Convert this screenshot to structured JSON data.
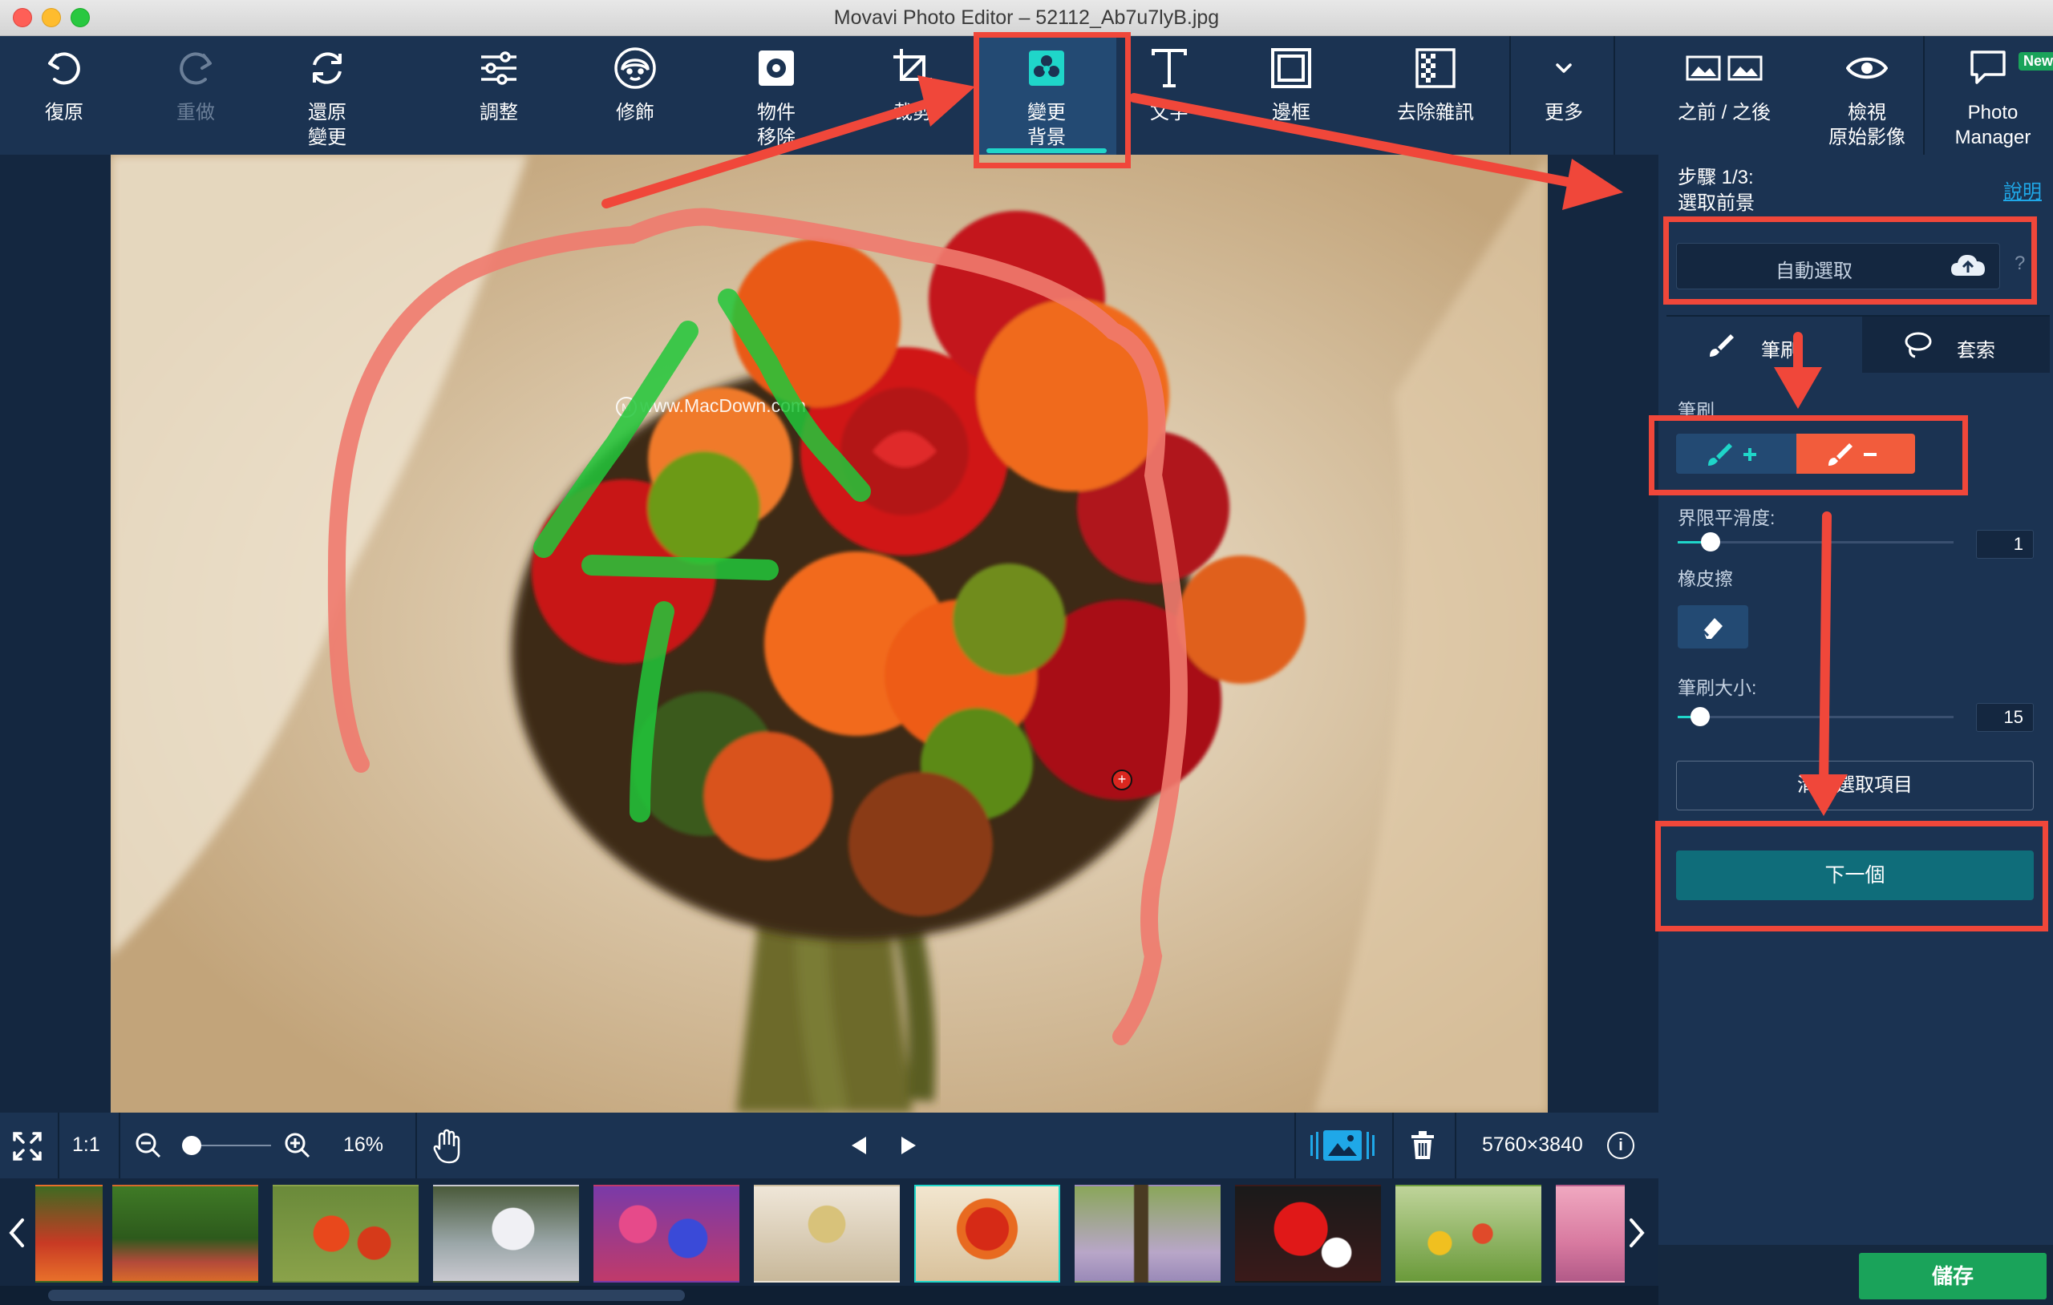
{
  "window": {
    "title": "Movavi Photo Editor – 52112_Ab7u7lyB.jpg"
  },
  "toolbar": {
    "undo": "復原",
    "redo": "重做",
    "reset": "還原\n變更",
    "adjust": "調整",
    "retouch": "修飾",
    "object_removal": "物件\n移除",
    "crop": "裁剪",
    "change_bg": "變更\n背景",
    "text": "文字",
    "frames": "邊框",
    "denoise": "去除雜訊",
    "more": "更多",
    "before_after": "之前 / 之後",
    "view_original": "檢視\n原始影像",
    "photo_manager": "Photo\nManager",
    "new_badge": "New"
  },
  "canvas": {
    "watermark": "www.MacDown.com"
  },
  "panel": {
    "step": "步驟 1/3:",
    "step_sub": "選取前景",
    "help": "說明",
    "auto_select": "自動選取",
    "tab_brush": "筆刷",
    "tab_lasso": "套索",
    "brush_label": "筆刷",
    "smoothness_label": "界限平滑度:",
    "smoothness_value": "1",
    "smoothness_level": 0.12,
    "eraser_label": "橡皮擦",
    "brush_size_label": "筆刷大小:",
    "brush_size_value": "15",
    "brush_size_level": 0.08,
    "clear_selection": "清除選取項目",
    "next": "下一個",
    "save": "儲存"
  },
  "bottombar": {
    "one_to_one": "1:1",
    "zoom": "16%",
    "zoom_level": 0.1,
    "dimensions": "5760×3840"
  },
  "colors": {
    "accent": "#1fd6c9",
    "save": "#1aa35a",
    "next": "#0f6d7a",
    "brush_minus": "#f25c3c",
    "annotation": "#f0473a"
  }
}
